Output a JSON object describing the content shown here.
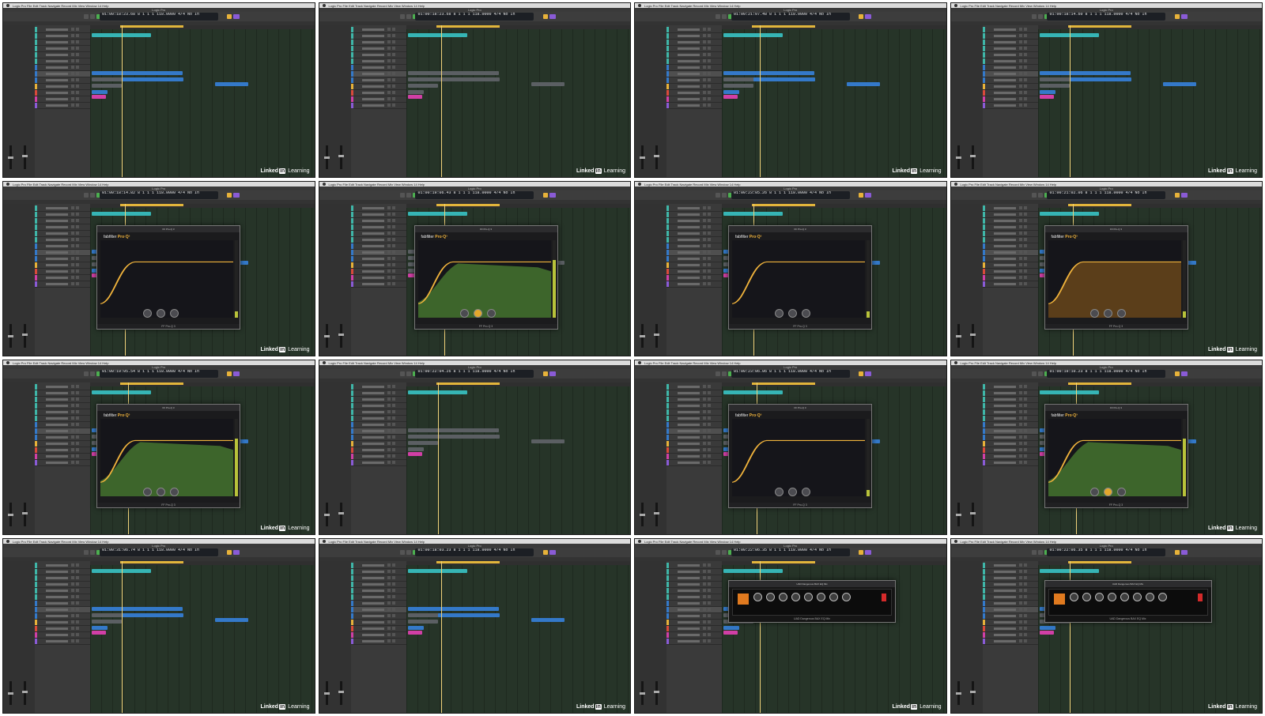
{
  "app": {
    "name": "Logic Pro"
  },
  "menu_items": [
    "Logic Pro",
    "File",
    "Edit",
    "Track",
    "Navigate",
    "Record",
    "Mix",
    "View",
    "Window",
    "14",
    "Help"
  ],
  "watermark": {
    "linked": "Linked",
    "in": "in",
    "learning": "Learning"
  },
  "frames": [
    {
      "lcd": "01:00:18:23.68  8 1 1 1  118.0000  4/4  No In",
      "plugin": null,
      "watermark": true
    },
    {
      "lcd": "01:00:18:23.68  8 1 1 1  118.0000  4/4  No In",
      "plugin": null,
      "watermark": true
    },
    {
      "lcd": "01:00:21:07.48  8 1 1 1  118.0000  4/4  No In",
      "plugin": null,
      "watermark": true
    },
    {
      "lcd": "01:00:18:14.60  8 1 1 1  118.0000  4/4  No In",
      "plugin": null,
      "watermark": true
    },
    {
      "lcd": "01:00:18:14.82  8 1 1 1  118.0000  4/4  No In",
      "plugin": "proq",
      "footer": "FF Pro-Q 3",
      "watermark": true
    },
    {
      "lcd": "01:00:19:06.43  8 1 1 1  118.0000  4/4  No In",
      "plugin": "proq-spectrum",
      "footer": "FF Pro-Q 3",
      "watermark": false
    },
    {
      "lcd": "01:00:23:05.26  8 1 1 1  118.0000  4/4  No In",
      "plugin": "proq",
      "footer": "FF Pro-Q 3",
      "watermark": false
    },
    {
      "lcd": "01:00:21:02.06  8 1 1 1  118.0000  4/4  No In",
      "plugin": "proq-orange",
      "footer": "FF Pro-Q 3",
      "watermark": true
    },
    {
      "lcd": "01:00:19:05.54  8 1 1 1  118.0000  4/4  No In",
      "plugin": "proq-spectrum",
      "footer": "FF Pro-Q 3",
      "watermark": true
    },
    {
      "lcd": "01:00:22:04.26  8 1 1 1  118.0000  4/4  No In",
      "plugin": null,
      "watermark": false
    },
    {
      "lcd": "01:00:23:06.06  8 1 1 1  118.0000  4/4  No In",
      "plugin": "proq",
      "footer": "FF Pro-Q 3",
      "watermark": false
    },
    {
      "lcd": "01:00:19:10.23  8 1 1 1  118.0000  4/4  No In",
      "plugin": "proq-spectrum",
      "footer": "FF Pro-Q 3",
      "watermark": true
    },
    {
      "lcd": "01:00:31:06.74  8 1 1 1  118.0000  4/4  No In",
      "plugin": null,
      "watermark": true
    },
    {
      "lcd": "01:00:18:03.23  8 1 1 1  118.0000  4/4  No In",
      "plugin": null,
      "watermark": true
    },
    {
      "lcd": "01:00:22:06.35  8 1 1 1  118.0000  4/4  No In",
      "plugin": "uad",
      "footer": "UAD Dangerous BAX EQ Mix",
      "watermark": true
    },
    {
      "lcd": "01:00:22:06.35  8 1 1 1  118.0000  4/4  No In",
      "plugin": "uad",
      "footer": "UAD Dangerous BAX EQ Mix",
      "watermark": true
    }
  ],
  "colors": {
    "arrange_bg": "#263428",
    "cyan_region": "#36b5b5",
    "blue_region": "#3479c9",
    "magenta_region": "#d13fa6",
    "eq_curve": "#f0b33c",
    "spectrum": "#5fa83a"
  }
}
